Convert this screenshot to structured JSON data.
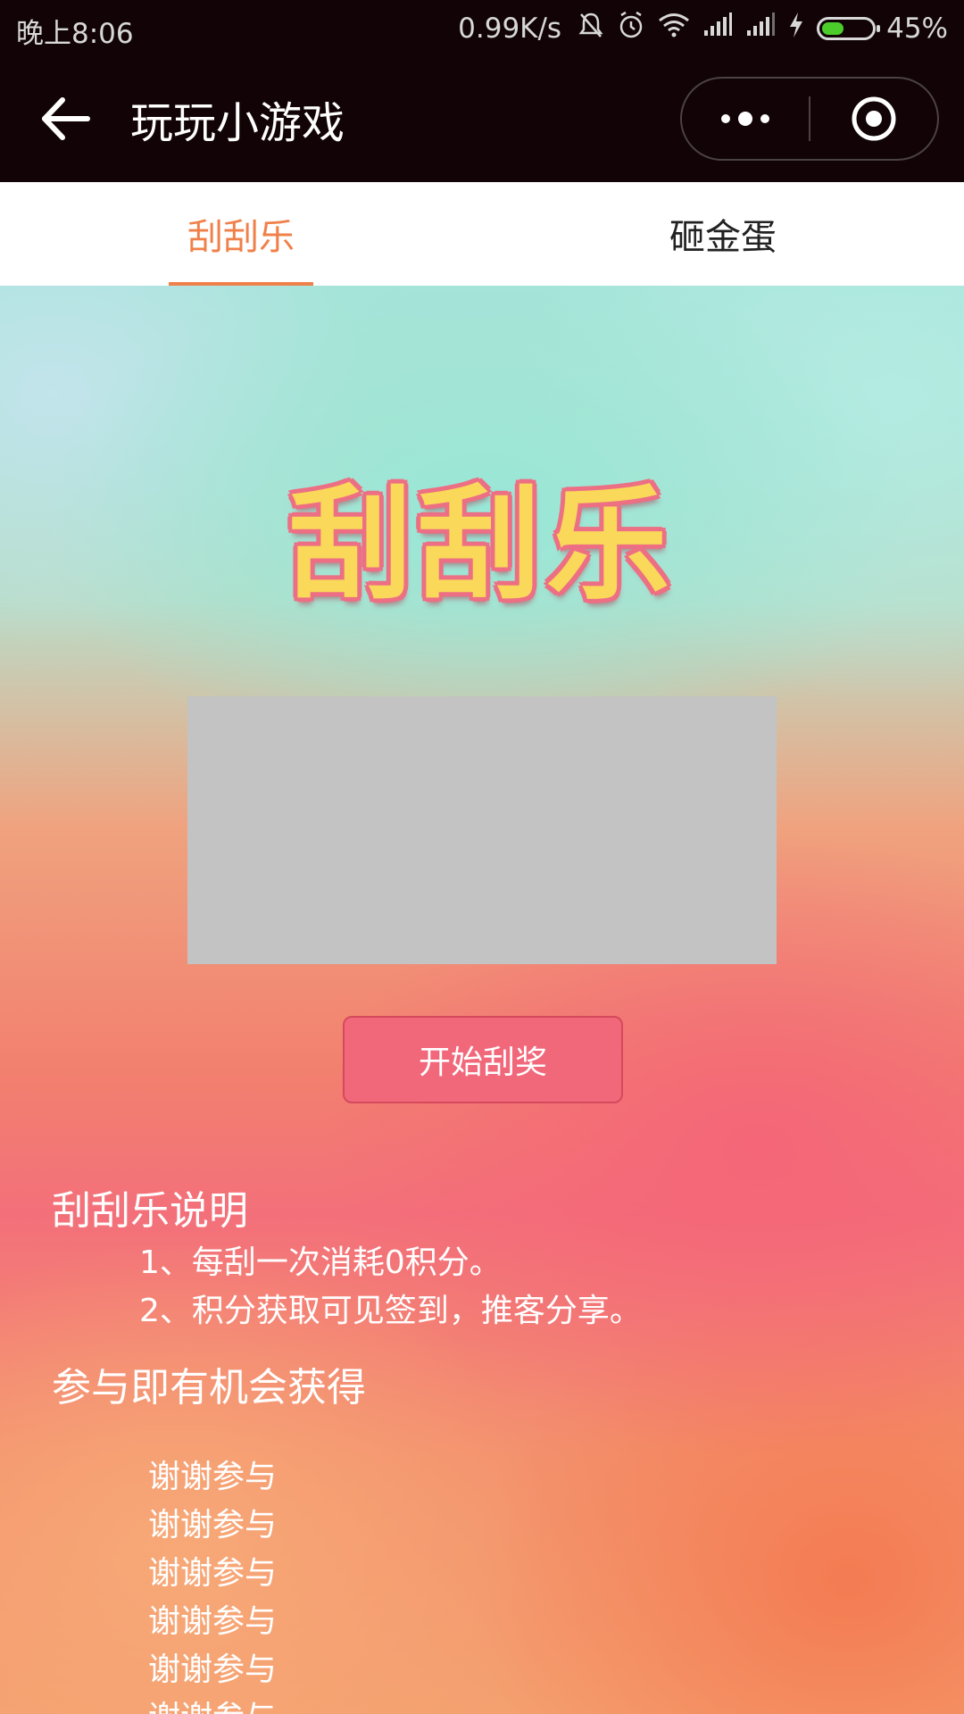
{
  "status_bar": {
    "time": "晚上8:06",
    "network_speed": "0.99K/s",
    "icons": [
      "mute-bell-icon",
      "alarm-clock-icon",
      "wifi-icon",
      "signal-icon",
      "signal-icon",
      "charging-bolt-icon"
    ],
    "battery_level": 0.45,
    "battery_percent": "45%"
  },
  "nav": {
    "title": "玩玩小游戏",
    "back_icon": "arrow-left-icon",
    "more_icon": "more-dots-icon",
    "close_icon": "target-circle-icon"
  },
  "tabs": [
    {
      "label": "刮刮乐",
      "active": true
    },
    {
      "label": "砸金蛋",
      "active": false
    }
  ],
  "game": {
    "title": "刮刮乐",
    "start_button": "开始刮奖"
  },
  "rules": {
    "title": "刮刮乐说明",
    "items": [
      "1、每刮一次消耗0积分。",
      "2、积分获取可见签到，推客分享。"
    ]
  },
  "prizes": {
    "title": "参与即有机会获得",
    "items": [
      "谢谢参与",
      "谢谢参与",
      "谢谢参与",
      "谢谢参与",
      "谢谢参与",
      "谢谢参与"
    ]
  },
  "colors": {
    "accent": "#f0804a",
    "nav_background": "#120406",
    "button_background": "#f1687b",
    "scratch_card": "#c3c3c3",
    "title_fill": "#f9d85a",
    "title_outline": "#ec6f84"
  }
}
